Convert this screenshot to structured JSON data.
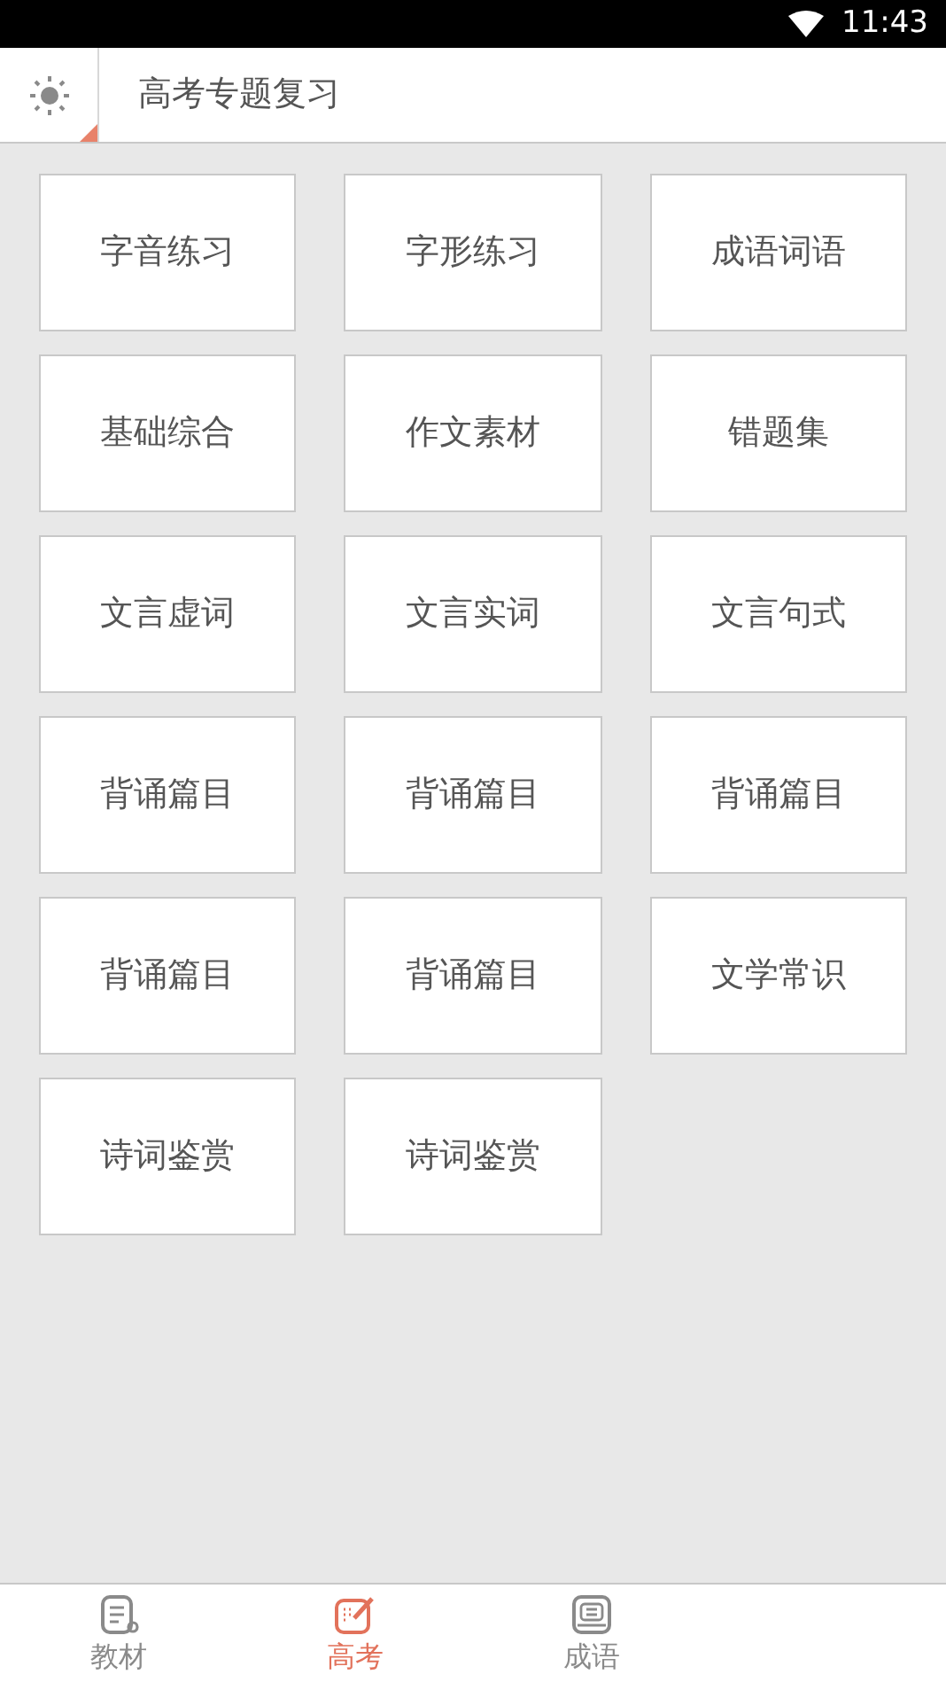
{
  "status_bar": {
    "time": "11:43"
  },
  "header": {
    "title": "高考专题复习"
  },
  "topics": [
    {
      "label": "字音练习"
    },
    {
      "label": "字形练习"
    },
    {
      "label": "成语词语"
    },
    {
      "label": "基础综合"
    },
    {
      "label": "作文素材"
    },
    {
      "label": "错题集"
    },
    {
      "label": "文言虚词"
    },
    {
      "label": "文言实词"
    },
    {
      "label": "文言句式"
    },
    {
      "label": "背诵篇目"
    },
    {
      "label": "背诵篇目"
    },
    {
      "label": "背诵篇目"
    },
    {
      "label": "背诵篇目"
    },
    {
      "label": "背诵篇目"
    },
    {
      "label": "文学常识"
    },
    {
      "label": "诗词鉴赏"
    },
    {
      "label": "诗词鉴赏"
    }
  ],
  "bottom_nav": [
    {
      "label": "教材",
      "kind": "book",
      "selected": false
    },
    {
      "label": "高考",
      "kind": "pen",
      "selected": true
    },
    {
      "label": "成语",
      "kind": "dict",
      "selected": false
    }
  ]
}
